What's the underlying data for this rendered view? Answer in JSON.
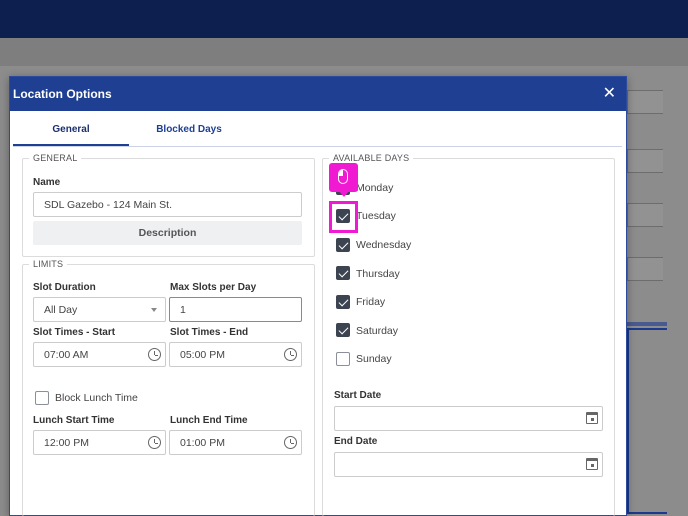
{
  "modal": {
    "title": "Location Options",
    "close_symbol": "✕",
    "tabs": [
      {
        "label": "General",
        "active": true
      },
      {
        "label": "Blocked Days",
        "active": false
      }
    ]
  },
  "general": {
    "legend": "GENERAL",
    "name_label": "Name",
    "name_value": "SDL Gazebo - 124 Main St.",
    "description_button": "Description"
  },
  "limits": {
    "legend": "LIMITS",
    "slot_duration_label": "Slot Duration",
    "slot_duration_value": "All Day",
    "max_slots_label": "Max Slots per Day",
    "max_slots_value": "1",
    "slot_start_label": "Slot Times - Start",
    "slot_start_value": "07:00 AM",
    "slot_end_label": "Slot Times - End",
    "slot_end_value": "05:00 PM",
    "block_lunch_label": "Block Lunch Time",
    "block_lunch_checked": false,
    "lunch_start_label": "Lunch Start Time",
    "lunch_start_value": "12:00 PM",
    "lunch_end_label": "Lunch End Time",
    "lunch_end_value": "01:00 PM"
  },
  "available_days": {
    "legend": "AVAILABLE DAYS",
    "days": [
      {
        "label": "Monday",
        "checked": true
      },
      {
        "label": "Tuesday",
        "checked": true
      },
      {
        "label": "Wednesday",
        "checked": true
      },
      {
        "label": "Thursday",
        "checked": true
      },
      {
        "label": "Friday",
        "checked": true
      },
      {
        "label": "Saturday",
        "checked": true
      },
      {
        "label": "Sunday",
        "checked": false
      }
    ],
    "start_date_label": "Start Date",
    "start_date_value": "",
    "end_date_label": "End Date",
    "end_date_value": ""
  },
  "icons": {
    "close": "close-icon",
    "clock": "clock-icon",
    "calendar": "calendar-icon",
    "select_arrow": "chevron-down-icon",
    "click_indicator": "mouse-icon"
  },
  "colors": {
    "header_blue": "#1e3f92",
    "highlight_magenta": "#f01ad2",
    "checkbox_checked": "#3d4451"
  }
}
